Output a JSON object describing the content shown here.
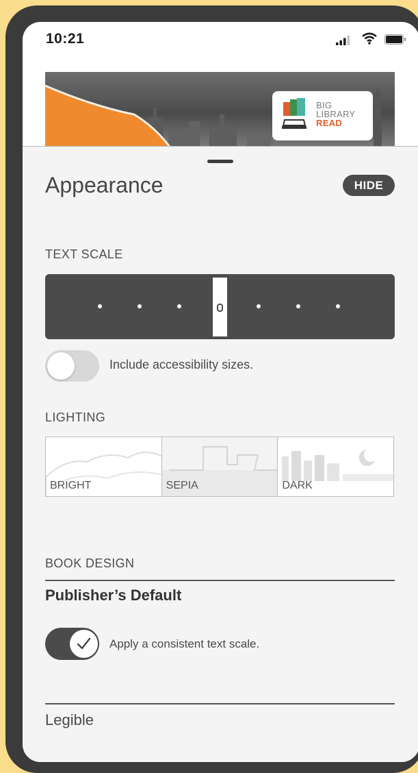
{
  "status_bar": {
    "time": "10:21",
    "icons": [
      "cellular-signal-icon",
      "wifi-icon",
      "battery-icon"
    ]
  },
  "banner": {
    "logo_lines": [
      "BIG",
      "LIBRARY",
      "READ"
    ],
    "colors": {
      "orange": "#ef8a2f",
      "logo_accent": "#e35f2a"
    }
  },
  "appearance": {
    "title": "Appearance",
    "hide_label": "HIDE",
    "text_scale": {
      "label": "TEXT SCALE",
      "steps": 7,
      "selected_step": 4
    },
    "accessibility_toggle": {
      "label": "Include accessibility sizes.",
      "on": false
    },
    "lighting": {
      "label": "LIGHTING",
      "options": [
        {
          "label": "BRIGHT",
          "icon": "hills-icon"
        },
        {
          "label": "SEPIA",
          "icon": "house-icon"
        },
        {
          "label": "DARK",
          "icon": "moon-city-icon"
        }
      ]
    },
    "book_design": {
      "label": "BOOK DESIGN",
      "selected": "Publisher’s Default",
      "consistent_toggle": {
        "label": "Apply a consistent text scale.",
        "on": true
      },
      "next_option": "Legible"
    }
  },
  "colors": {
    "background": "#f9dc8c",
    "phone_frame": "#3b3b3b",
    "dark_control": "#4b4b4b",
    "sheet": "#f4f4f4"
  }
}
